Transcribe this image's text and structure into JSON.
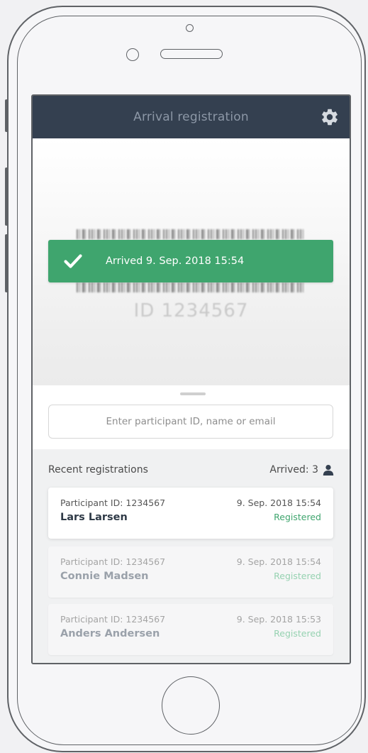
{
  "header": {
    "title": "Arrival registration",
    "settings_icon": "gear-icon"
  },
  "scanner": {
    "scan_id": "ID 1234567"
  },
  "toast": {
    "message": "Arrived 9. Sep. 2018 15:54",
    "icon": "check-icon"
  },
  "search": {
    "placeholder": "Enter participant ID, name or email",
    "value": ""
  },
  "recent": {
    "title": "Recent registrations",
    "arrived_label": "Arrived: 3",
    "arrived_icon": "user-icon",
    "items": [
      {
        "participant_id": "Participant ID: 1234567",
        "name": "Lars Larsen",
        "time": "9. Sep. 2018 15:54",
        "status": "Registered"
      },
      {
        "participant_id": "Participant ID: 1234567",
        "name": "Connie Madsen",
        "time": "9. Sep. 2018 15:54",
        "status": "Registered"
      },
      {
        "participant_id": "Participant ID: 1234567",
        "name": "Anders Andersen",
        "time": "9. Sep. 2018 15:53",
        "status": "Registered"
      }
    ]
  },
  "colors": {
    "header_bg": "#344050",
    "success": "#3fa56e",
    "page_bg": "#f0f1f2"
  }
}
